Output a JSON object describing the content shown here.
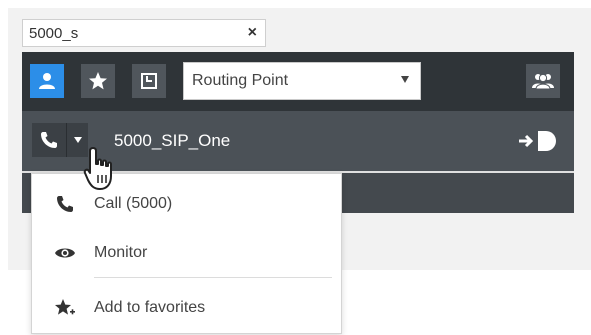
{
  "search": {
    "value": "5000_s",
    "clear_label": "×"
  },
  "toolbar": {
    "buttons": [
      {
        "icon": "person-icon",
        "active": true
      },
      {
        "icon": "star-icon",
        "active": false
      },
      {
        "icon": "clock-icon",
        "active": false
      },
      {
        "icon": "group-icon",
        "active": false
      }
    ],
    "filter_selected": "Routing Point"
  },
  "result": {
    "name": "5000_SIP_One",
    "call_icon": "phone-icon",
    "action_icon": "transfer-icon"
  },
  "menu": {
    "items": [
      {
        "label": "Call (5000)",
        "icon": "phone-icon"
      },
      {
        "label": "Monitor",
        "icon": "eye-icon"
      },
      {
        "label": "Add to favorites",
        "icon": "star-plus-icon"
      }
    ]
  },
  "colors": {
    "accent": "#2c8ee8",
    "toolbar": "#2f3438",
    "row": "#4b5157"
  }
}
